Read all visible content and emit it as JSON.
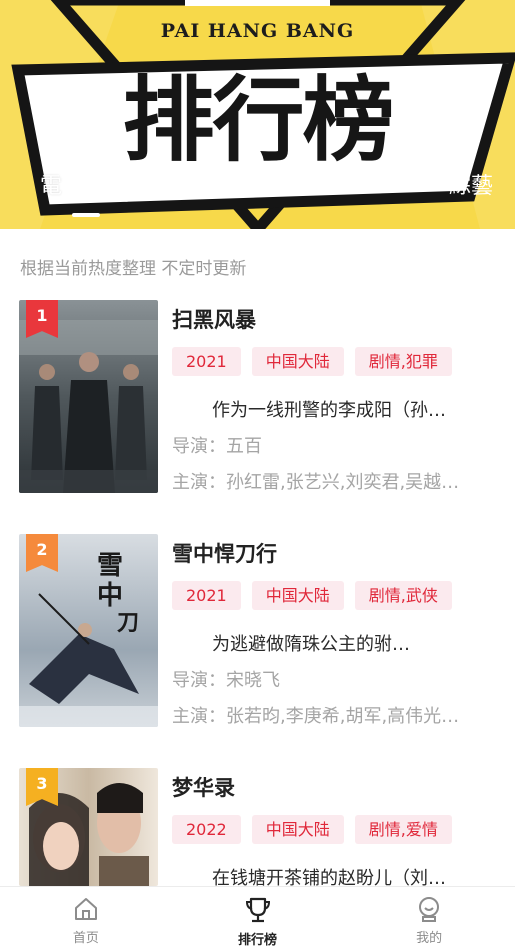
{
  "banner": {
    "subtitle": "PAI HANG BANG",
    "title": "排行榜",
    "tab_left": "電",
    "tab_right": "綜藝"
  },
  "note": "根据当前热度整理 不定时更新",
  "items": [
    {
      "rank": "1",
      "rank_color": "#e9373c",
      "title": "扫黑风暴",
      "tags": [
        "2021",
        "中国大陆",
        "剧情,犯罪"
      ],
      "desc": "作为一线刑警的李成阳（孙…",
      "director_label": "导演：",
      "director": "五百",
      "cast_label": "主演：",
      "cast": "孙红雷,张艺兴,刘奕君,吴越…"
    },
    {
      "rank": "2",
      "rank_color": "#f58a3c",
      "title": "雪中悍刀行",
      "tags": [
        "2021",
        "中国大陆",
        "剧情,武侠"
      ],
      "desc": "为逃避做隋珠公主的驸…",
      "director_label": "导演：",
      "director": "宋晓飞",
      "cast_label": "主演：",
      "cast": "张若昀,李庚希,胡军,高伟光…"
    },
    {
      "rank": "3",
      "rank_color": "#f5b021",
      "title": "梦华录",
      "tags": [
        "2022",
        "中国大陆",
        "剧情,爱情"
      ],
      "desc": "在钱塘开茶铺的赵盼儿（刘…",
      "director_label": "导演：",
      "director": "",
      "cast_label": "主演：",
      "cast": ""
    }
  ],
  "nav": [
    {
      "label": "首页",
      "icon": "home-icon"
    },
    {
      "label": "排行榜",
      "icon": "trophy-icon"
    },
    {
      "label": "我的",
      "icon": "profile-icon"
    }
  ],
  "colors": {
    "banner_yellow": "#f7d94a",
    "tag_text": "#e0283a",
    "tag_bg": "#fbeaee"
  }
}
